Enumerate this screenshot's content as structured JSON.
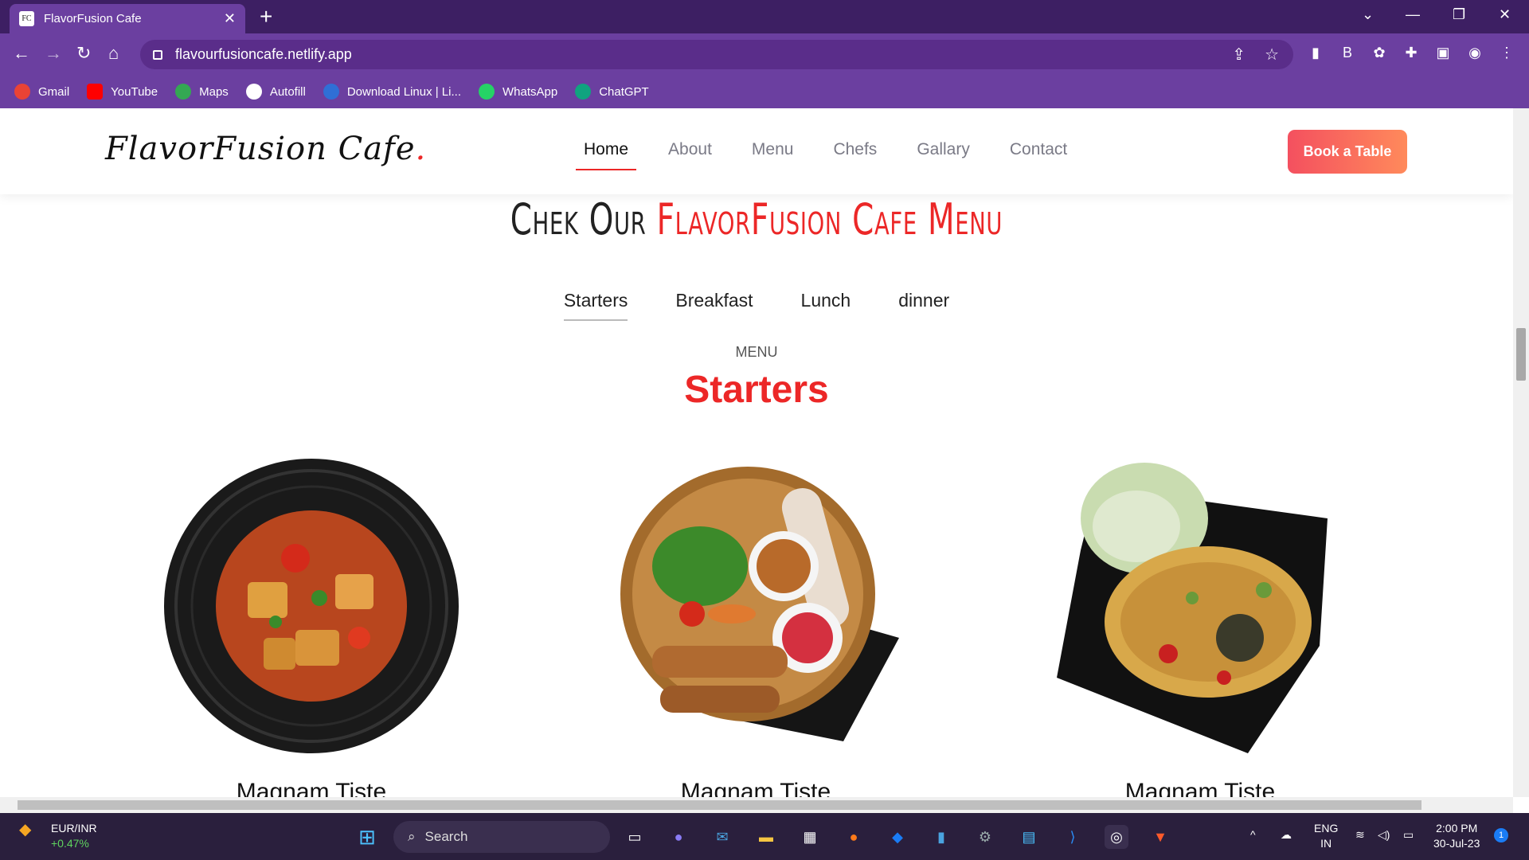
{
  "browser": {
    "tab_title": "FlavorFusion Cafe",
    "favicon_text": "FC",
    "url": "flavourfusioncafe.netlify.app",
    "bookmarks": [
      {
        "label": "Gmail",
        "color": "#ea4335"
      },
      {
        "label": "YouTube",
        "color": "#ff0000"
      },
      {
        "label": "Maps",
        "color": "#34a853"
      },
      {
        "label": "Autofill",
        "color": "#ffffff"
      },
      {
        "label": "Download Linux | Li...",
        "color": "#2f6fd6"
      },
      {
        "label": "WhatsApp",
        "color": "#25d366"
      },
      {
        "label": "ChatGPT",
        "color": "#10a37f"
      }
    ]
  },
  "site": {
    "logo": "FlavorFusion Cafe",
    "logo_dot": ".",
    "nav": [
      "Home",
      "About",
      "Menu",
      "Chefs",
      "Gallary",
      "Contact"
    ],
    "book_button": "Book a Table"
  },
  "menu": {
    "title_dark": "Chek Our",
    "title_red": "FlavorFusion Cafe Menu",
    "tabs": [
      "Starters",
      "Breakfast",
      "Lunch",
      "dinner"
    ],
    "section_label": "MENU",
    "section_title": "Starters",
    "dishes": [
      {
        "name": "Magnam Tiste"
      },
      {
        "name": "Magnam Tiste"
      },
      {
        "name": "Magnam Tiste"
      }
    ]
  },
  "taskbar": {
    "ticker": "EUR/INR",
    "ticker_change": "+0.47%",
    "search_label": "Search",
    "language": "ENG",
    "region": "IN",
    "time": "2:00 PM",
    "date": "30-Jul-23",
    "notification_count": "1"
  },
  "colors": {
    "accent": "#ec2727",
    "browser_frame": "#6b3fa0"
  }
}
